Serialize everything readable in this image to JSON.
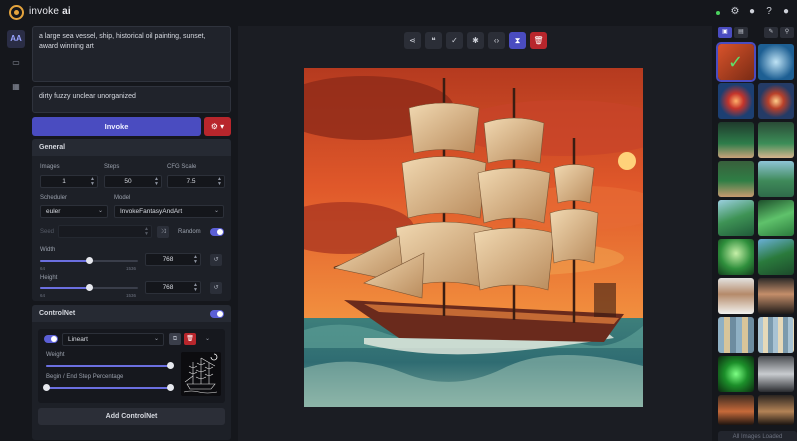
{
  "app": {
    "brand_plain": "invoke",
    "brand_bold": "ai"
  },
  "prompts": {
    "positive": "a large sea vessel, ship, historical oil painting, sunset, award winning art",
    "negative": "dirty fuzzy unclear unorganized"
  },
  "invoke": {
    "label": "Invoke"
  },
  "general": {
    "title": "General",
    "images_label": "Images",
    "images_value": "1",
    "steps_label": "Steps",
    "steps_value": "50",
    "cfg_label": "CFG Scale",
    "cfg_value": "7.5",
    "scheduler_label": "Scheduler",
    "scheduler_value": "euler",
    "model_label": "Model",
    "model_value": "InvokeFantasyAndArt",
    "seed_label": "Seed",
    "random_label": "Random",
    "random_on": true,
    "width_label": "Width",
    "width_value": "768",
    "width_fraction": 0.5,
    "height_label": "Height",
    "height_value": "768",
    "height_fraction": 0.5,
    "slider_min": "64",
    "slider_max": "1536"
  },
  "controlnet": {
    "title": "ControlNet",
    "model_value": "Lineart",
    "weight_label": "Weight",
    "weight_fraction": 1.0,
    "steps_label": "Begin / End Step Percentage",
    "begin_fraction": 0.0,
    "end_fraction": 1.0,
    "add_label": "Add ControlNet"
  },
  "gallery": {
    "footer": "All Images Loaded"
  },
  "colors": {
    "accent": "#4a4cc0",
    "danger": "#b8262c",
    "brand": "#e5a43d",
    "status": "#4ad15e"
  }
}
